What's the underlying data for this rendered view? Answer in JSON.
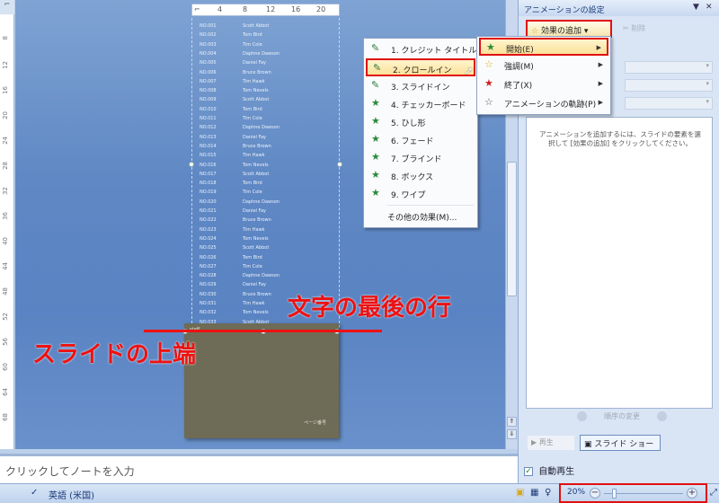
{
  "ruler": {
    "horizontal_ticks": [
      "4",
      "8",
      "12",
      "16",
      "20"
    ],
    "vertical_ticks": [
      "8",
      "12",
      "16",
      "20",
      "24",
      "28",
      "32",
      "36",
      "40",
      "44",
      "48",
      "52",
      "56",
      "60",
      "64",
      "68"
    ]
  },
  "slide": {
    "text_lines": [
      {
        "a": "NO.001",
        "b": "Scott Abbot"
      },
      {
        "a": "NO.002",
        "b": "Tom Bird"
      },
      {
        "a": "NO.003",
        "b": "Tim Cole"
      },
      {
        "a": "NO.004",
        "b": "Daphne Dawson"
      },
      {
        "a": "NO.005",
        "b": "Daniel Fay"
      },
      {
        "a": "NO.006",
        "b": "Bruce Brown"
      },
      {
        "a": "NO.007",
        "b": "Tim Hawk"
      },
      {
        "a": "NO.008",
        "b": "Tom Nevels"
      },
      {
        "a": "NO.009",
        "b": "Scott Abbot"
      },
      {
        "a": "NO.010",
        "b": "Tom Bird"
      },
      {
        "a": "NO.011",
        "b": "Tim Cole"
      },
      {
        "a": "NO.012",
        "b": "Daphne Dawson"
      },
      {
        "a": "NO.013",
        "b": "Daniel Fay"
      },
      {
        "a": "NO.014",
        "b": "Bruce Brown"
      },
      {
        "a": "NO.015",
        "b": "Tim Hawk"
      },
      {
        "a": "NO.016",
        "b": "Tom Nevels"
      },
      {
        "a": "NO.017",
        "b": "Scott Abbot"
      },
      {
        "a": "NO.018",
        "b": "Tom Bird"
      },
      {
        "a": "NO.019",
        "b": "Tim Cole"
      },
      {
        "a": "NO.020",
        "b": "Daphne Dawson"
      },
      {
        "a": "NO.021",
        "b": "Daniel Fay"
      },
      {
        "a": "NO.022",
        "b": "Bruce Brown"
      },
      {
        "a": "NO.023",
        "b": "Tim Hawk"
      },
      {
        "a": "NO.024",
        "b": "Tom Nevels"
      },
      {
        "a": "NO.025",
        "b": "Scott Abbot"
      },
      {
        "a": "NO.026",
        "b": "Tom Bird"
      },
      {
        "a": "NO.027",
        "b": "Tim Cole"
      },
      {
        "a": "NO.028",
        "b": "Daphne Dawson"
      },
      {
        "a": "NO.029",
        "b": "Daniel Fay"
      },
      {
        "a": "NO.030",
        "b": "Bruce Brown"
      },
      {
        "a": "NO.031",
        "b": "Tim Hawk"
      },
      {
        "a": "NO.032",
        "b": "Tom Nevels"
      },
      {
        "a": "NO.033",
        "b": "Scott Abbot"
      }
    ],
    "title_text": "staff",
    "footer_text": "ページ番号"
  },
  "annotations": {
    "last_line": "文字の最後の行",
    "slide_top": "スライドの上端"
  },
  "notes": {
    "placeholder": "クリックしてノートを入力"
  },
  "statusbar": {
    "language": "英語 (米国)",
    "zoom_percent": "20%",
    "zoom_level": 0.1
  },
  "taskpane": {
    "title": "アニメーションの設定",
    "add_effect_label": "効果の追加",
    "remove_label": "削除",
    "help_message": "アニメーションを追加するには、スライドの要素を選択して [効果の追加] をクリックしてください。",
    "reorder_label": "順序の変更",
    "play_label": "再生",
    "slideshow_label": "スライド ショー",
    "autoplay_label": "自動再生",
    "autoplay_checked": true
  },
  "category_menu": {
    "items": [
      {
        "label": "開始(E)",
        "icon": "green-star-icon",
        "color": "#2a8a3a"
      },
      {
        "label": "強調(M)",
        "icon": "yellow-star-icon",
        "color": "#d9a818"
      },
      {
        "label": "終了(X)",
        "icon": "red-star-icon",
        "color": "#d02020"
      },
      {
        "label": "アニメーションの軌跡(P)",
        "icon": "outline-star-icon",
        "color": "#555555"
      }
    ]
  },
  "effects_menu": {
    "items": [
      {
        "label": "1. クレジット タイトル",
        "icon": "pen-icon"
      },
      {
        "label": "2. クロールイン",
        "icon": "pen-icon"
      },
      {
        "label": "3. スライドイン",
        "icon": "pen-icon"
      },
      {
        "label": "4. チェッカーボード",
        "icon": "star-icon"
      },
      {
        "label": "5. ひし形",
        "icon": "star-icon"
      },
      {
        "label": "6. フェード",
        "icon": "star-icon"
      },
      {
        "label": "7. ブラインド",
        "icon": "star-icon"
      },
      {
        "label": "8. ボックス",
        "icon": "star-icon"
      },
      {
        "label": "9. ワイプ",
        "icon": "star-icon"
      }
    ],
    "more_label": "その他の効果(M)..."
  }
}
